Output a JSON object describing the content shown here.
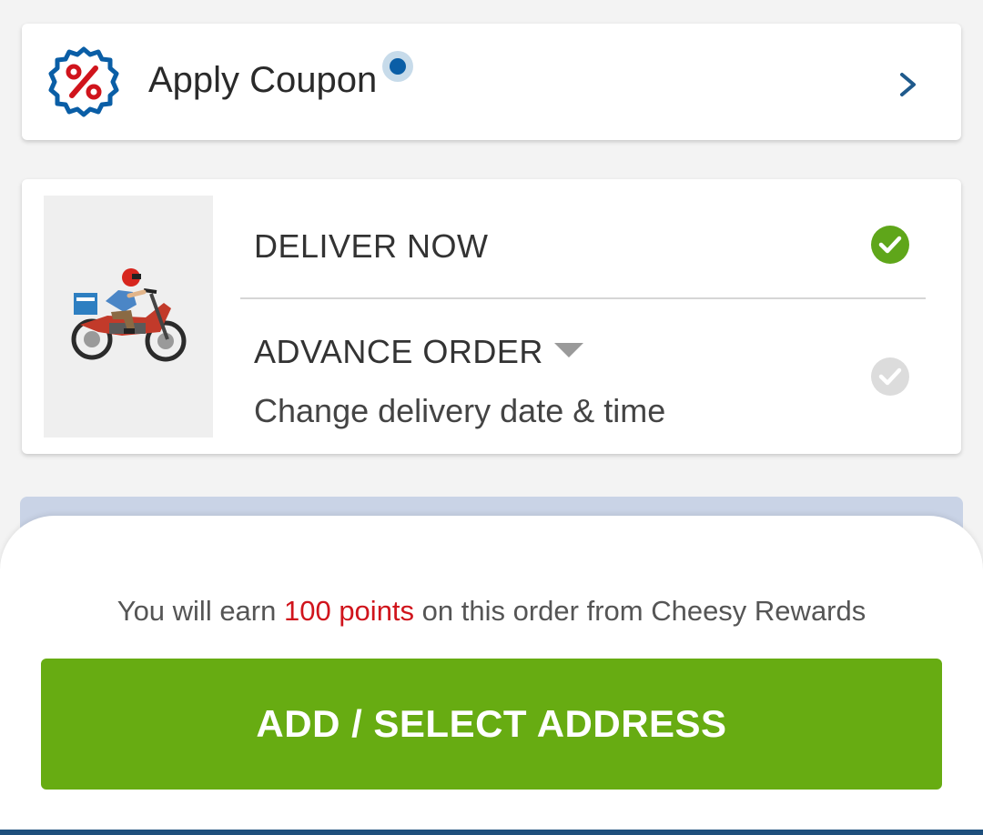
{
  "coupon": {
    "label": "Apply Coupon",
    "icon": "percent-badge-icon",
    "arrow_icon": "chevron-right-icon",
    "has_notification": true
  },
  "delivery": {
    "illustration": "delivery-scooter-illustration",
    "deliver_now_label": "DELIVER NOW",
    "deliver_now_selected": true,
    "advance_order_label": "ADVANCE ORDER",
    "advance_order_subtitle": "Change delivery date & time",
    "advance_order_selected": false
  },
  "footer": {
    "rewards_prefix": "You will earn ",
    "rewards_points": "100 points",
    "rewards_suffix": " on this order from Cheesy Rewards",
    "cta_label": "ADD / SELECT ADDRESS"
  },
  "colors": {
    "accent_green": "#67ac12",
    "check_green": "#5fa61a",
    "points_red": "#d0141c",
    "brand_blue": "#0a5ea6",
    "bottom_bar": "#1e4f7c"
  }
}
